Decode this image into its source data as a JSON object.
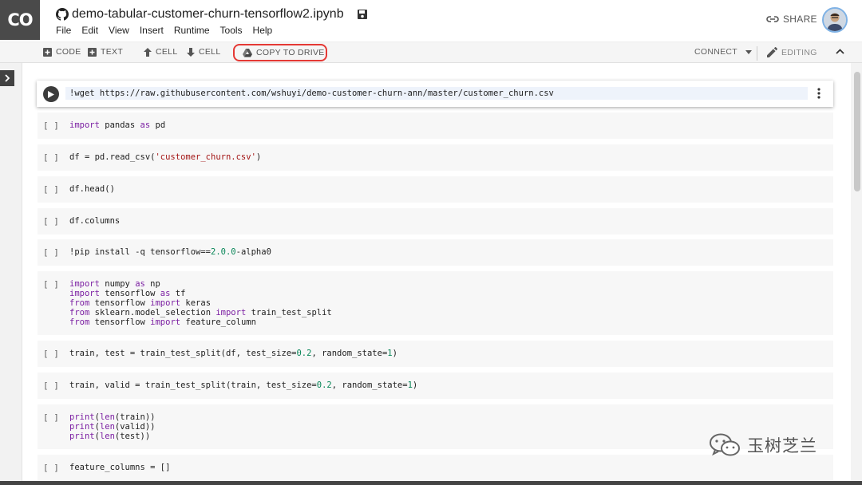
{
  "app": {
    "logo_text": "CO",
    "notebook_title": "demo-tabular-customer-churn-tensorflow2.ipynb"
  },
  "menu": [
    "File",
    "Edit",
    "View",
    "Insert",
    "Runtime",
    "Tools",
    "Help"
  ],
  "header": {
    "share_label": "SHARE"
  },
  "toolbar": {
    "code_label": "CODE",
    "text_label": "TEXT",
    "cell_up_label": "CELL",
    "cell_down_label": "CELL",
    "copy_to_drive_label": "COPY TO DRIVE",
    "connect_label": "CONNECT",
    "editing_label": "EDITING"
  },
  "cells": [
    {
      "bracket": "",
      "lines": [
        "!wget https://raw.githubusercontent.com/wshuyi/demo-customer-churn-ann/master/customer_churn.csv"
      ]
    },
    {
      "bracket": "[ ]",
      "lines": [
        "import pandas as pd"
      ]
    },
    {
      "bracket": "[ ]",
      "lines": [
        "df = pd.read_csv('customer_churn.csv')"
      ]
    },
    {
      "bracket": "[ ]",
      "lines": [
        "df.head()"
      ]
    },
    {
      "bracket": "[ ]",
      "lines": [
        "df.columns"
      ]
    },
    {
      "bracket": "[ ]",
      "lines": [
        "!pip install -q tensorflow==2.0.0-alpha0"
      ]
    },
    {
      "bracket": "[ ]",
      "lines": [
        "import numpy as np",
        "import tensorflow as tf",
        "from tensorflow import keras",
        "from sklearn.model_selection import train_test_split",
        "from tensorflow import feature_column"
      ]
    },
    {
      "bracket": "[ ]",
      "lines": [
        "train, test = train_test_split(df, test_size=0.2, random_state=1)"
      ]
    },
    {
      "bracket": "[ ]",
      "lines": [
        "train, valid = train_test_split(train, test_size=0.2, random_state=1)"
      ]
    },
    {
      "bracket": "[ ]",
      "lines": [
        "print(len(train))",
        "print(len(valid))",
        "print(len(test))"
      ]
    },
    {
      "bracket": "[ ]",
      "lines": [
        "feature_columns = []"
      ]
    }
  ],
  "watermark": {
    "text": "玉树芝兰"
  },
  "colors": {
    "keyword": "#7b1fa2",
    "string": "#a31515",
    "number": "#098658",
    "highlight": "#e53935"
  }
}
